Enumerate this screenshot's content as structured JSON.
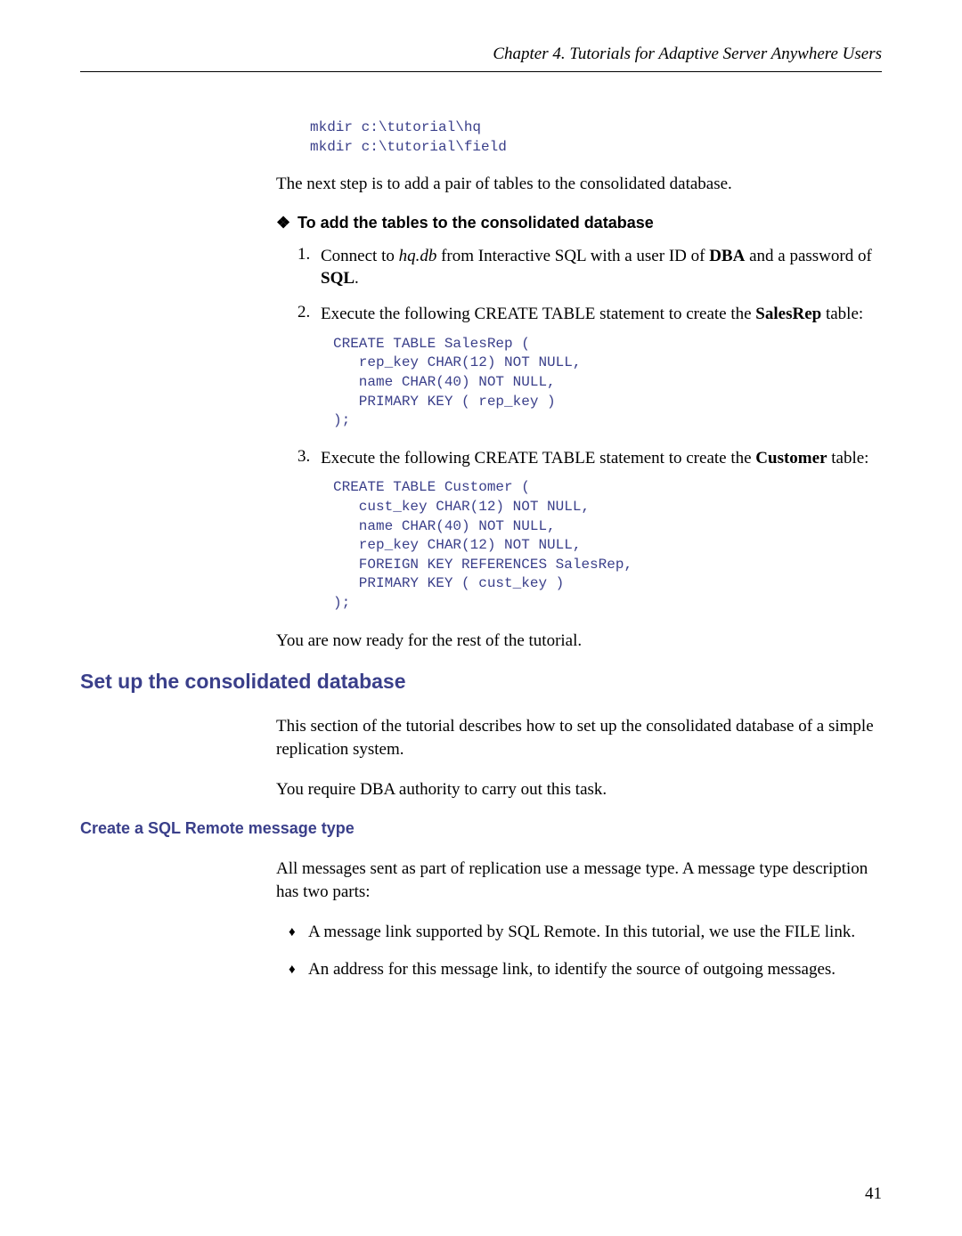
{
  "header": "Chapter 4.  Tutorials for Adaptive Server Anywhere Users",
  "code_mkdir": "mkdir c:\\tutorial\\hq\nmkdir c:\\tutorial\\field",
  "para_next_step": "The next step is to add a pair of tables to the consolidated database.",
  "proc_title": "To add the tables to the consolidated database",
  "diamond": "❖",
  "steps": {
    "s1": {
      "num": "1.",
      "pre": "Connect to ",
      "hqdb": "hq.db",
      "mid": " from Interactive SQL with a user ID of ",
      "dba": "DBA",
      "mid2": " and a password of ",
      "sql": "SQL",
      "end": "."
    },
    "s2": {
      "num": "2.",
      "text_pre": "Execute the following CREATE TABLE statement to create the ",
      "bold": "SalesRep",
      "text_post": " table:",
      "code": "CREATE TABLE SalesRep (\n   rep_key CHAR(12) NOT NULL,\n   name CHAR(40) NOT NULL,\n   PRIMARY KEY ( rep_key )\n);"
    },
    "s3": {
      "num": "3.",
      "text_pre": "Execute the following CREATE TABLE statement to create the ",
      "bold": "Customer",
      "text_post": " table:",
      "code": "CREATE TABLE Customer (\n   cust_key CHAR(12) NOT NULL,\n   name CHAR(40) NOT NULL,\n   rep_key CHAR(12) NOT NULL,\n   FOREIGN KEY REFERENCES SalesRep,\n   PRIMARY KEY ( cust_key )\n);"
    }
  },
  "para_ready": "You are now ready for the rest of the tutorial.",
  "section_h2": "Set up the consolidated database",
  "para_section1": "This section of the tutorial describes how to set up the consolidated database of a simple replication system.",
  "para_section2": "You require DBA authority to carry out this task.",
  "section_h3": "Create a SQL Remote message type",
  "para_msg": "All messages sent as part of replication use a message type. A message type description has two parts:",
  "bullet_marker": "♦",
  "bullets": {
    "b1": "A message link supported by SQL Remote. In this tutorial, we use the FILE link.",
    "b2": "An address for this message link, to identify the source of outgoing messages."
  },
  "page_number": "41"
}
